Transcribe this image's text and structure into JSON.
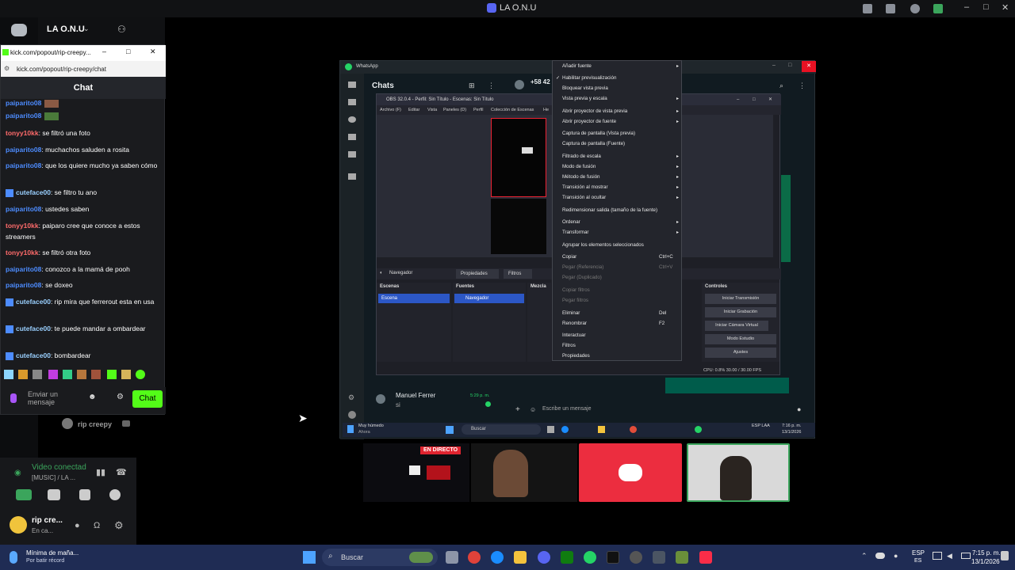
{
  "window": {
    "title": "LA O.N.U"
  },
  "server": {
    "name": "LA O.N.U"
  },
  "popup": {
    "title": "kick.com/popout/rip-creepy...",
    "url": "kick.com/popout/rip-creepy/chat",
    "chat_header": "Chat",
    "messages": [
      {
        "user": "paiparito08",
        "text": "",
        "color": "blue"
      },
      {
        "user": "tonyy10kk",
        "text": ": se filtró una foto",
        "color": "red"
      },
      {
        "user": "paiparito08",
        "text": ": muchachos saluden a rosita",
        "color": "blue"
      },
      {
        "user": "paiparito08",
        "text": ": que los quiere mucho ya saben cómo",
        "color": "blue"
      },
      {
        "user": "cuteface00",
        "text": ": se filtro tu ano",
        "color": "blue"
      },
      {
        "user": "paiparito08",
        "text": ": ustedes saben",
        "color": "blue"
      },
      {
        "user": "tonyy10kk",
        "text": ": paiparo cree que conoce a estos streamers",
        "color": "red"
      },
      {
        "user": "tonyy10kk",
        "text": ": se filtró otra foto",
        "color": "red"
      },
      {
        "user": "paiparito08",
        "text": ": conozco a la mamá de pooh",
        "color": "blue"
      },
      {
        "user": "paiparito08",
        "text": ": se doxeo",
        "color": "blue"
      },
      {
        "user": "cuteface00",
        "text": ": rip mira que ferrerout esta en usa",
        "color": "blue"
      },
      {
        "user": "cuteface00",
        "text": ": te puede mandar a ombardear",
        "color": "blue"
      },
      {
        "user": "cuteface00",
        "text": ": bombardear",
        "color": "blue"
      }
    ],
    "input_placeholder": "Enviar un mensaje",
    "send_label": "Chat"
  },
  "voice": {
    "member": "rip creepy",
    "status": "Video conectad",
    "channel": "[MUSIC] / LA ...",
    "user_name": "rip cre...",
    "user_status": "En ca..."
  },
  "whatsapp": {
    "title": "WhatsApp",
    "chats_label": "Chats",
    "contact_number": "+58 42",
    "bottom_contact": "Manuel Ferrer",
    "bottom_text": "si",
    "bottom_time": "5:29 p. m.",
    "compose_placeholder": "Escribe un mensaje",
    "weather_line1": "Muy húmedo",
    "weather_line2": "Ahora",
    "search": "Buscar",
    "lang": "ESP LAA",
    "clock_time": "7:16 p. m.",
    "clock_date": "13/1/2026"
  },
  "obs": {
    "title": "OBS 32.0.4 - Perfil: Sin Título - Escenas: Sin Título",
    "menu": [
      "Archivo (F)",
      "Editar",
      "Vista",
      "Paneles (D)",
      "Perfil",
      "Colección de Escenas",
      "He"
    ],
    "tabs": [
      "Navegador",
      "Propiedades",
      "Filtros"
    ],
    "scenes_label": "Escenas",
    "scene_item": "Escena",
    "sources_label": "Fuentes",
    "source_item": "Navegador",
    "mixer_label": "Mezcla",
    "controls_label": "Controles",
    "controls": [
      "Iniciar Transmisión",
      "Iniciar Grabación",
      "Iniciar Cámara Virtual",
      "Modo Estudio",
      "Ajustes"
    ],
    "status": "CPU: 0.8%   30.00 / 30.00 FPS"
  },
  "context_menu": [
    {
      "label": "Añadir fuente",
      "sub": true
    },
    {
      "label": "Habilitar previsualización",
      "check": true
    },
    {
      "label": "Bloquear vista previa"
    },
    {
      "label": "Vista previa y escala",
      "sub": true
    },
    {
      "label": "Abrir proyector de vista previa",
      "sub": true
    },
    {
      "label": "Abrir proyector de fuente",
      "sub": true
    },
    {
      "label": "Captura de pantalla (Vista previa)"
    },
    {
      "label": "Captura de pantalla (Fuente)"
    },
    {
      "label": "Filtrado de escala",
      "sub": true
    },
    {
      "label": "Modo de fusión",
      "sub": true
    },
    {
      "label": "Método de fusión",
      "sub": true
    },
    {
      "label": "Transición al mostrar",
      "sub": true
    },
    {
      "label": "Transición al ocultar",
      "sub": true
    },
    {
      "label": "Redimensionar salida (tamaño de la fuente)"
    },
    {
      "label": "Ordenar",
      "sub": true
    },
    {
      "label": "Transformar",
      "sub": true
    },
    {
      "label": "Agrupar los elementos seleccionados"
    },
    {
      "label": "Copiar",
      "shortcut": "Ctrl+C"
    },
    {
      "label": "Pegar (Referencia)",
      "shortcut": "Ctrl+V",
      "disabled": true
    },
    {
      "label": "Pegar (Duplicado)",
      "disabled": true
    },
    {
      "label": "Copiar filtros",
      "disabled": true
    },
    {
      "label": "Pegar filtros",
      "disabled": true
    },
    {
      "label": "Eliminar",
      "shortcut": "Del"
    },
    {
      "label": "Renombrar",
      "shortcut": "F2"
    },
    {
      "label": "Interactuar"
    },
    {
      "label": "Filtros"
    },
    {
      "label": "Propiedades"
    }
  ],
  "streams": {
    "live_badge": "EN DIRECTO"
  },
  "taskbar": {
    "weather_line1": "Mínima de maña...",
    "weather_line2": "Por batir récord",
    "search": "Buscar",
    "lang1": "ESP",
    "lang2": "ES",
    "time": "7:15 p. m.",
    "date": "13/1/2026"
  }
}
